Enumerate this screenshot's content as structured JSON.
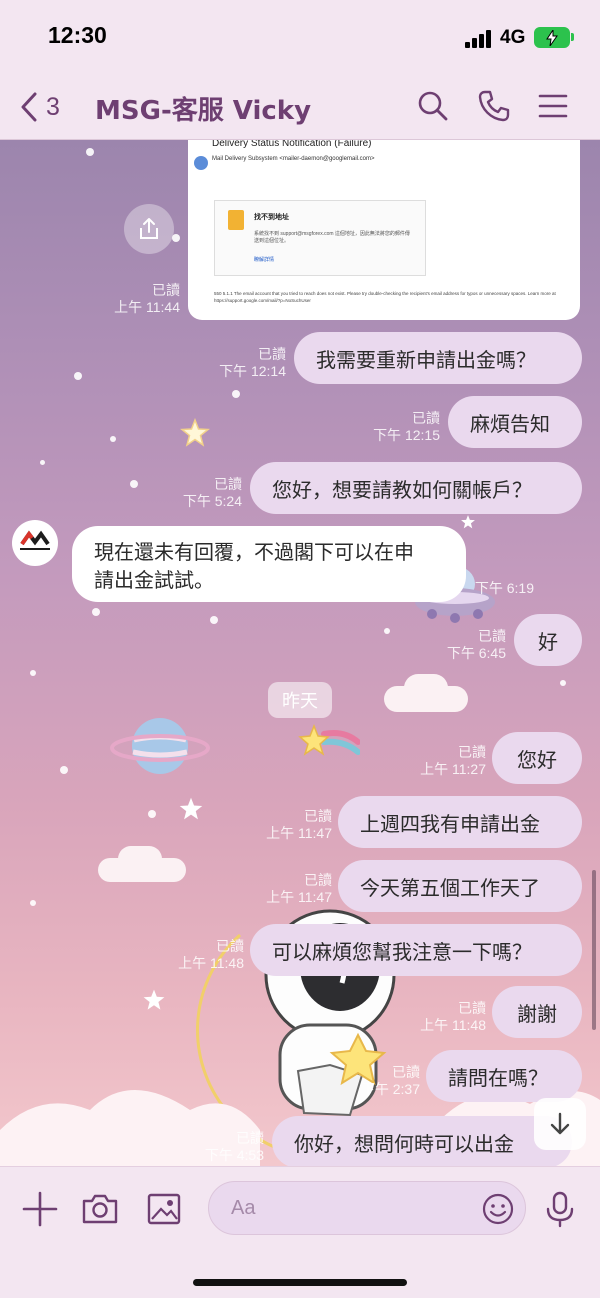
{
  "status": {
    "time": "12:30",
    "network": "4G"
  },
  "header": {
    "unread_count": "3",
    "title": "MSG-客服 Vicky"
  },
  "email_preview": {
    "subject": "Delivery Status Notification (Failure)",
    "sender": "Mail Delivery Subsystem <mailer-daemon@googlemail.com>",
    "box_title": "找不到地址",
    "box_body": "系統找不到 support@msgforex.com 這個地址，因此無法將您的郵件傳送到這個位址。",
    "box_link": "瞭解詳情",
    "footer": "550 5.1.1 The email account that you tried to reach does not exist. Please try double-checking the recipient's email address for typos or unnecessary spaces. Learn more at https://support.google.com/mail/?p=NoSuchUser"
  },
  "messages": [
    {
      "dir": "out",
      "text": "我需要重新申請出金嗎？",
      "read": "已讀",
      "time": "下午 12:14"
    },
    {
      "dir": "out",
      "text": "麻煩告知",
      "read": "已讀",
      "time": "下午 12:15"
    },
    {
      "dir": "out",
      "text": "您好，想要請教如何關帳戶？",
      "read": "已讀",
      "time": "下午 5:24"
    },
    {
      "dir": "in",
      "text_line1": "現在還未有回覆，不過閣下可以在申",
      "text_line2": "請出金試試。",
      "time": "下午 6:19"
    },
    {
      "dir": "out",
      "text": "好",
      "read": "已讀",
      "time": "下午 6:45"
    },
    {
      "dir": "out",
      "text": "您好",
      "read": "已讀",
      "time": "上午 11:27"
    },
    {
      "dir": "out",
      "text": "上週四我有申請出金",
      "read": "已讀",
      "time": "上午 11:47"
    },
    {
      "dir": "out",
      "text": "今天第五個工作天了",
      "read": "已讀",
      "time": "上午 11:47"
    },
    {
      "dir": "out",
      "text": "可以麻煩您幫我注意一下嗎？",
      "read": "已讀",
      "time": "上午 11:48"
    },
    {
      "dir": "out",
      "text": "謝謝",
      "read": "已讀",
      "time": "上午 11:48"
    },
    {
      "dir": "out",
      "text": "請問在嗎？",
      "read": "已讀",
      "time": "下午 2:37"
    },
    {
      "dir": "out",
      "text": "你好，想問何時可以出金",
      "read": "已讀",
      "time": "下午 4:53"
    }
  ],
  "first_meta": {
    "read": "已讀",
    "time": "上午 11:44"
  },
  "date_separator": "昨天",
  "input": {
    "placeholder": "Aa"
  },
  "colors": {
    "accent": "#6e3f72",
    "bubble_out": "#ead9ee",
    "bubble_in": "#ffffff"
  }
}
